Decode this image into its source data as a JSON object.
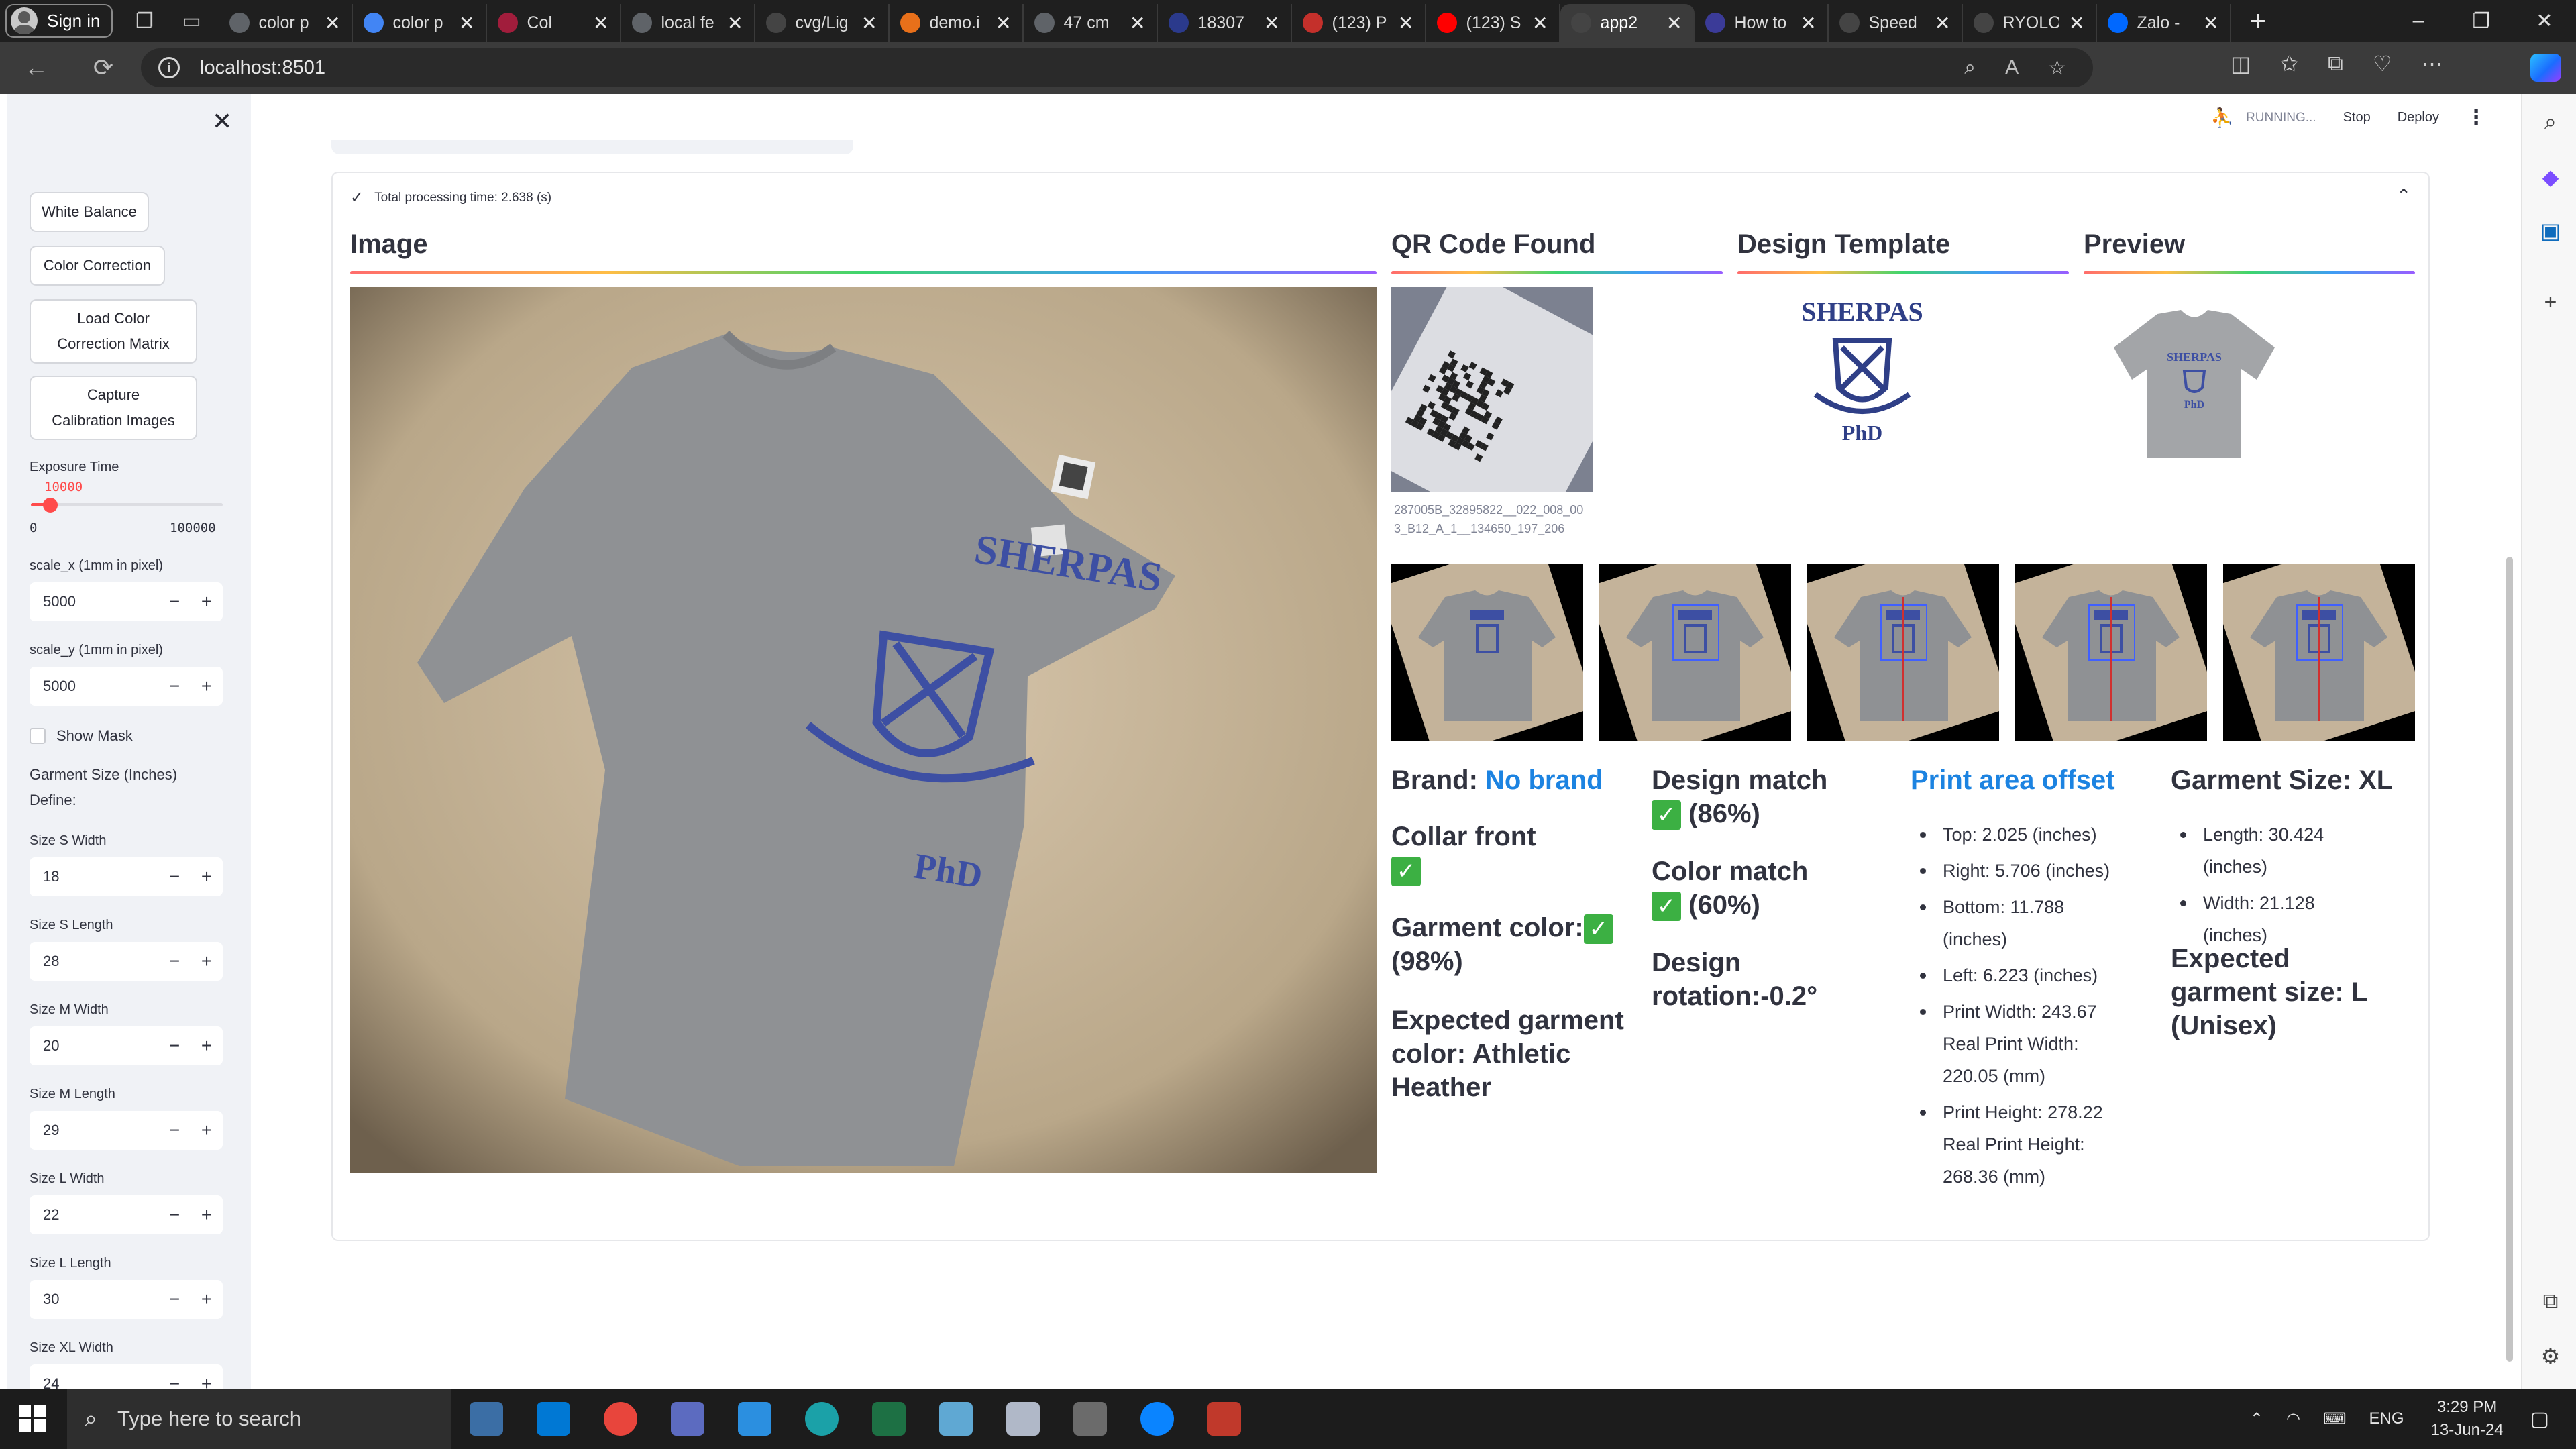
{
  "browser": {
    "sign_in_label": "Sign in",
    "tabs": [
      {
        "title": "color p",
        "color": "#5f6368"
      },
      {
        "title": "color p",
        "color": "#4285f4"
      },
      {
        "title": "Col",
        "color": "#a11d3c"
      },
      {
        "title": "local fe",
        "color": "#5f6368"
      },
      {
        "title": "cvg/Lig",
        "color": "#444444"
      },
      {
        "title": "demo.i",
        "color": "#e8701a"
      },
      {
        "title": "47 cm",
        "color": "#5f6368"
      },
      {
        "title": "18307",
        "color": "#2b3a8c"
      },
      {
        "title": "(123) P",
        "color": "#c4302b"
      },
      {
        "title": "(123) S",
        "color": "#ff0000"
      },
      {
        "title": "app2",
        "color": "#444444"
      },
      {
        "title": "How to",
        "color": "#3b3b98"
      },
      {
        "title": "Speed",
        "color": "#444444"
      },
      {
        "title": "RYOLO",
        "color": "#444444"
      },
      {
        "title": "Zalo -",
        "color": "#0068ff"
      }
    ],
    "url": "localhost:8501"
  },
  "sidebar": {
    "buttons": {
      "white_balance": "White Balance",
      "color_correction": "Color Correction",
      "load_ccm": "Load Color Correction Matrix",
      "capture_calibration": "Capture Calibration Images"
    },
    "exposure": {
      "label": "Exposure Time",
      "value": "10000",
      "min": "0",
      "max": "100000",
      "fraction": 0.1
    },
    "scale_x": {
      "label": "scale_x (1mm in pixel)",
      "value": "5000"
    },
    "scale_y": {
      "label": "scale_y (1mm in pixel)",
      "value": "5000"
    },
    "show_mask_label": "Show Mask",
    "garment_size_title": "Garment Size (Inches)",
    "define_label": "Define:",
    "sizes": [
      {
        "label": "Size S Width",
        "value": "18"
      },
      {
        "label": "Size S Length",
        "value": "28"
      },
      {
        "label": "Size M Width",
        "value": "20"
      },
      {
        "label": "Size M Length",
        "value": "29"
      },
      {
        "label": "Size L Width",
        "value": "22"
      },
      {
        "label": "Size L Length",
        "value": "30"
      },
      {
        "label": "Size XL Width",
        "value": "24"
      }
    ]
  },
  "header": {
    "running": "RUNNING...",
    "stop": "Stop",
    "deploy": "Deploy"
  },
  "result": {
    "processing_time": "Total processing time: 2.638 (s)",
    "headers": {
      "image": "Image",
      "qr": "QR Code Found",
      "design": "Design Template",
      "preview": "Preview"
    },
    "shirt_text_top": "SHERPAS",
    "shirt_text_bottom": "PhD",
    "qr_caption": "287005B_32895822__022_008_003_B12_A_1__134650_197_206",
    "brand_label": "Brand:",
    "brand_value": "No brand",
    "collar": "Collar front",
    "garment_color": "Garment color:",
    "garment_color_pct": "(98%)",
    "expected_color": "Expected garment color: Athletic Heather",
    "design_match": "Design match",
    "design_match_pct": "(86%)",
    "color_match": "Color match",
    "color_match_pct": "(60%)",
    "design_rotation": "Design rotation:-0.2°",
    "print_offset_title": "Print area offset",
    "offsets": [
      "Top: 2.025 (inches)",
      "Right: 5.706 (inches)",
      "Bottom: 11.788 (inches)",
      "Left: 6.223 (inches)",
      "Print Width: 243.67 Real Print Width: 220.05 (mm)",
      "Print Height: 278.22 Real Print Height: 268.36 (mm)"
    ],
    "garment_size": "Garment Size: XL",
    "garment_dims": [
      "Length: 30.424 (inches)",
      "Width: 21.128 (inches)"
    ],
    "expected_size": "Expected garment size: L (Unisex)"
  },
  "taskbar": {
    "search_placeholder": "Type here to search",
    "lang": "ENG",
    "time": "3:29 PM",
    "date": "13-Jun-24"
  },
  "colors": {
    "accent": "#ff4b4b",
    "link": "#1c83e1",
    "shirt": "#8f9194",
    "print": "#3d4fa3"
  }
}
